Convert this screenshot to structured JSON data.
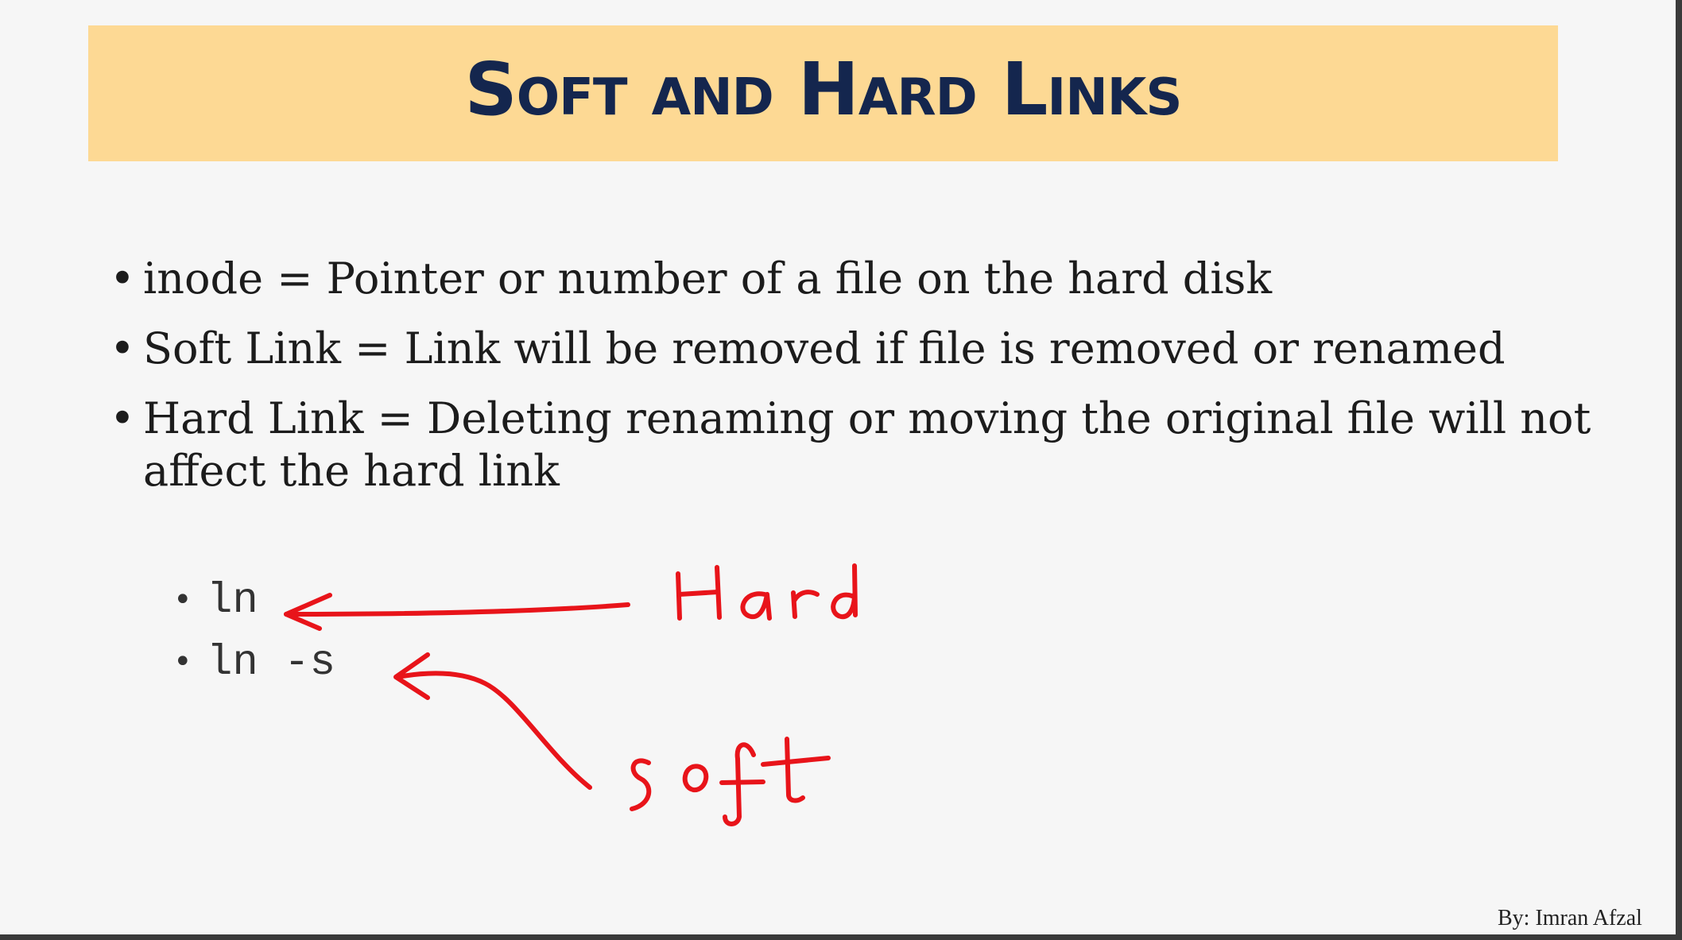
{
  "slide": {
    "title": "Soft and Hard Links",
    "bullets": [
      {
        "term": "inode",
        "sep": " = ",
        "desc": "Pointer or number of a file on the hard disk"
      },
      {
        "term": "Soft Link",
        "sep": " = ",
        "desc": "Link will be removed if file is removed or renamed"
      },
      {
        "term": "Hard Link",
        "sep": " = ",
        "desc": "Deleting renaming or moving the original file will not affect the hard link"
      }
    ],
    "commands": [
      "ln",
      "ln -s"
    ],
    "annotations": {
      "hard": "Hard",
      "soft": "soft",
      "color": "#e8141a"
    },
    "footer": "By: Imran Afzal"
  },
  "colors": {
    "title_band": "#fdd994",
    "title_text": "#14264e",
    "background": "#f6f6f6"
  }
}
